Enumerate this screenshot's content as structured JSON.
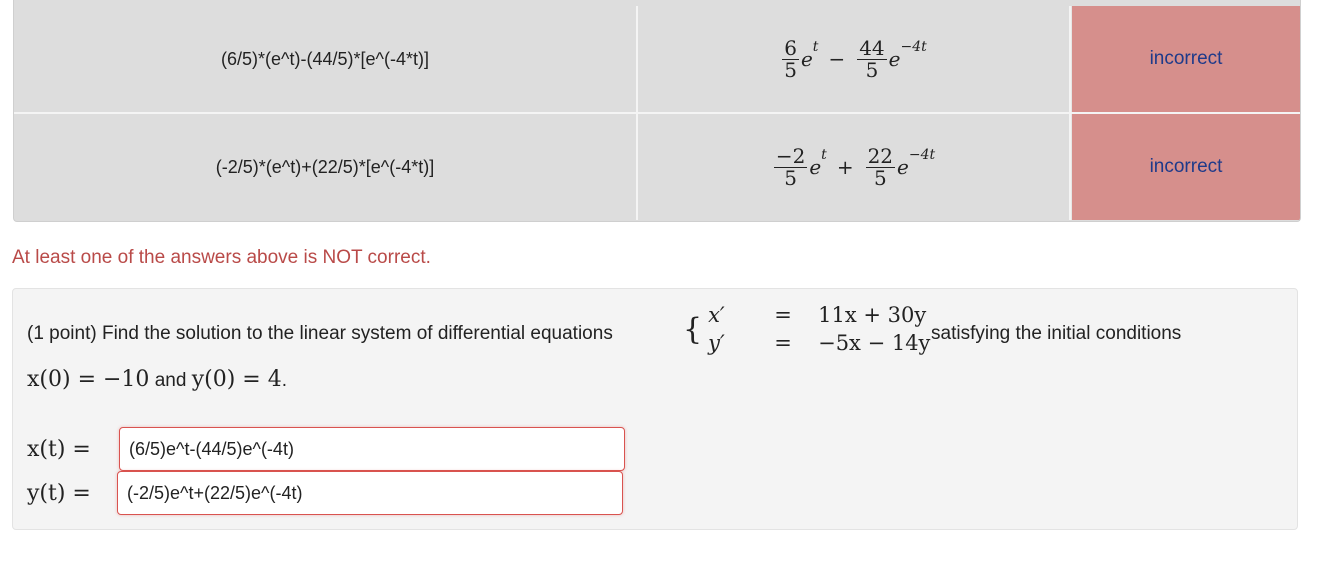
{
  "results": {
    "rows": [
      {
        "entered": "(6/5)*(e^t)-(44/5)*[e^(-4*t)]",
        "preview": {
          "f1_num": "6",
          "f1_den": "5",
          "e1": "e",
          "exp1": "t",
          "op": "−",
          "f2_num": "44",
          "f2_den": "5",
          "e2": "e",
          "exp2": "−4t"
        },
        "result": "incorrect"
      },
      {
        "entered": "(-2/5)*(e^t)+(22/5)*[e^(-4*t)]",
        "preview": {
          "f1_num": "−2",
          "f1_den": "5",
          "e1": "e",
          "exp1": "t",
          "op": "+",
          "f2_num": "22",
          "f2_den": "5",
          "e2": "e",
          "exp2": "−4t"
        },
        "result": "incorrect"
      }
    ],
    "result_color": "#d68f8c"
  },
  "feedback": "At least one of the answers above is NOT correct.",
  "problem": {
    "text": "(1 point) Find the solution to the linear system of differential equations",
    "system": {
      "row1": {
        "lhs": "x′",
        "eq": "=",
        "rhs": "11x + 30y"
      },
      "row2": {
        "lhs": "y′",
        "eq": "=",
        "rhs": "−5x − 14y"
      }
    },
    "tail": "satisfying the initial conditions",
    "init_x": "x(0) = −10",
    "init_and": "and",
    "init_y": "y(0) = 4",
    "init_end": ".",
    "answers": [
      {
        "label": "x(t) =",
        "value": "(6/5)e^t-(44/5)e^(-4t)"
      },
      {
        "label": "y(t) =",
        "value": "(-2/5)e^t+(22/5)e^(-4t)"
      }
    ]
  }
}
